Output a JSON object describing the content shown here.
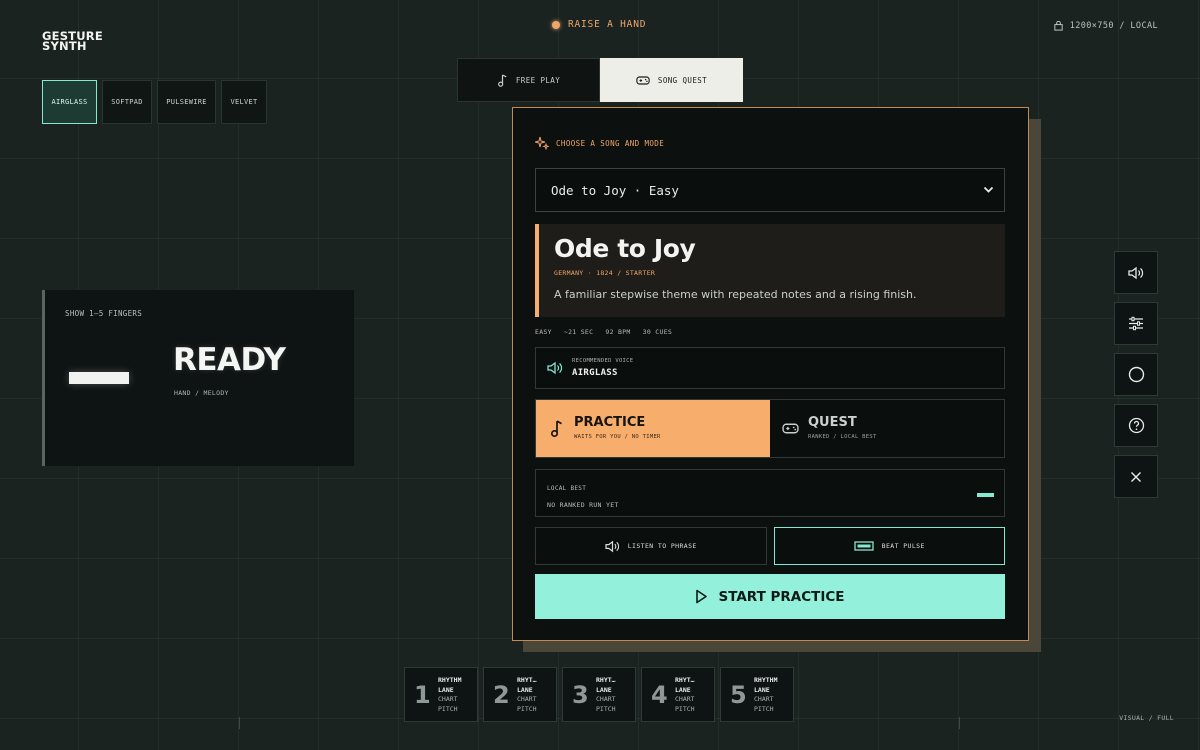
{
  "brand": {
    "line1": "GESTURE",
    "line2": "SYNTH"
  },
  "status": {
    "label": "RAISE A HAND",
    "color": "#f0a56a"
  },
  "resolution": {
    "label": "1200×750 / LOCAL",
    "icon": "lock-icon"
  },
  "voices": [
    "AIRGLASS",
    "SOFTPAD",
    "PULSEWIRE",
    "VELVET"
  ],
  "voices_active": "AIRGLASS",
  "mode_tabs": [
    {
      "label": "FREE PLAY",
      "icon": "music-note-icon",
      "active": false
    },
    {
      "label": "SONG QUEST",
      "icon": "gamepad-icon",
      "active": true
    }
  ],
  "ready_card": {
    "hint": "SHOW 1–5 FINGERS",
    "title": "READY",
    "subtitle": "HAND / MELODY"
  },
  "panel": {
    "choose_label": "CHOOSE A SONG AND MODE",
    "song_select": "Ode to Joy · Easy",
    "song": {
      "name": "Ode to Joy",
      "meta": "GERMANY · 1824 / STARTER",
      "description": "A familiar stepwise theme with repeated notes and a rising finish."
    },
    "stats": [
      "EASY",
      "~21 SEC",
      "92 BPM",
      "30 CUES"
    ],
    "recommended_voice": {
      "label": "RECOMMENDED VOICE",
      "value": "AIRGLASS"
    },
    "modes": [
      {
        "title": "PRACTICE",
        "subtitle": "WAITS FOR YOU / NO TIMER",
        "icon": "music-note-icon",
        "active": true
      },
      {
        "title": "QUEST",
        "subtitle": "RANKED / LOCAL BEST",
        "icon": "gamepad-icon",
        "active": false
      }
    ],
    "local_best": {
      "label": "LOCAL BEST",
      "value": "NO RANKED RUN YET"
    },
    "listen_label": "LISTEN TO PHRASE",
    "beat_label": "BEAT PULSE",
    "start_label": "START PRACTICE"
  },
  "tools": [
    "speaker-icon",
    "sliders-icon",
    "circle-icon",
    "help-icon",
    "close-icon"
  ],
  "lanes": [
    {
      "num": "1",
      "title": "RHYTHM",
      "line2": "LANE",
      "line3": "CHART",
      "line4": "PITCH"
    },
    {
      "num": "2",
      "title": "RHYT…",
      "line2": "LANE",
      "line3": "CHART",
      "line4": "PITCH"
    },
    {
      "num": "3",
      "title": "RHYT…",
      "line2": "LANE",
      "line3": "CHART",
      "line4": "PITCH"
    },
    {
      "num": "4",
      "title": "RHYT…",
      "line2": "LANE",
      "line3": "CHART",
      "line4": "PITCH"
    },
    {
      "num": "5",
      "title": "RHYTHM",
      "line2": "LANE",
      "line3": "CHART",
      "line4": "PITCH"
    }
  ],
  "footer": {
    "visual": "VISUAL / FULL"
  },
  "colors": {
    "accent_orange": "#f7ad6c",
    "accent_mint": "#93f0db",
    "background": "#1a2320"
  }
}
